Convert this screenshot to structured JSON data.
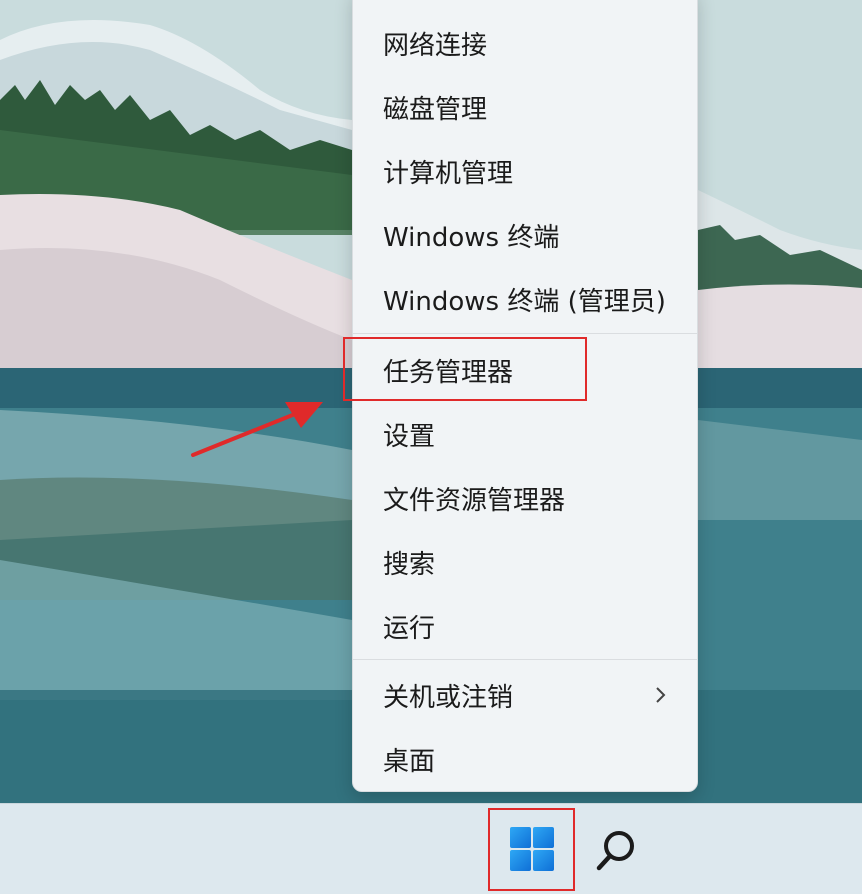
{
  "context_menu": {
    "items": [
      {
        "label": "网络连接"
      },
      {
        "label": "磁盘管理"
      },
      {
        "label": "计算机管理"
      },
      {
        "label": "Windows 终端"
      },
      {
        "label": "Windows 终端 (管理员)"
      },
      {
        "label": "任务管理器"
      },
      {
        "label": "设置"
      },
      {
        "label": "文件资源管理器"
      },
      {
        "label": "搜索"
      },
      {
        "label": "运行"
      },
      {
        "label": "关机或注销"
      },
      {
        "label": "桌面"
      }
    ]
  },
  "annotations": {
    "highlight_color": "#e02a2a",
    "highlighted_item": "任务管理器"
  },
  "taskbar": {
    "start_icon": "windows-logo-icon",
    "search_icon": "search-icon",
    "accent_color": "#1a8ae6"
  }
}
